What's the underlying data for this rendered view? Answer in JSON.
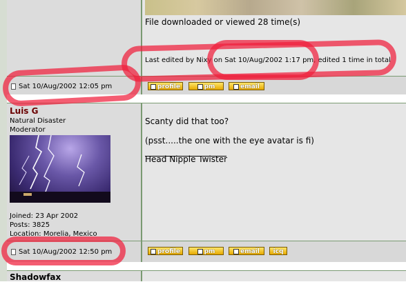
{
  "post1": {
    "downloads_text": "File downloaded or viewed 28 time(s)",
    "edit_note": "Last edited by Nixy on Sat 10/Aug/2002 1:17 pm, edited 1 time in total",
    "date": "Sat 10/Aug/2002 12:05 pm",
    "buttons": {
      "profile": "profile",
      "pm": "pm",
      "email": "email"
    }
  },
  "post2": {
    "username": "Luis G",
    "rank1": "Natural Disaster",
    "rank2": "Moderator",
    "joined": "Joined: 23 Apr 2002",
    "posts": "Posts: 3825",
    "location": "Location: Morelia, Mexico",
    "body1": "Scanty did that too?",
    "body2": "(psst.....the one with the eye avatar is fi)",
    "signature": "Head Nipple Twister",
    "date": "Sat 10/Aug/2002 12:50 pm",
    "buttons": {
      "profile": "profile",
      "pm": "pm",
      "email": "email",
      "icq": "icq"
    }
  },
  "post3": {
    "username": "Shadowfax"
  },
  "colors": {
    "annotation": "#f01e3c",
    "username": "#6a0000",
    "button": "#f0b800"
  },
  "icons": [
    "document-icon",
    "profile-icon",
    "pm-icon",
    "email-icon",
    "icq-icon"
  ]
}
